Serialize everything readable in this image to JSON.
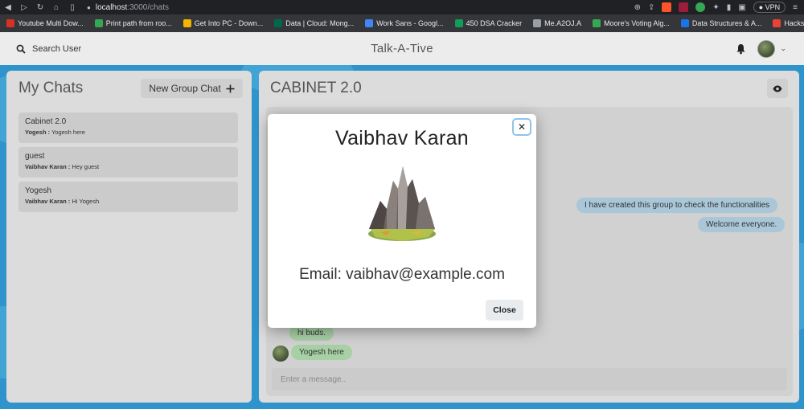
{
  "browser": {
    "url_host": "localhost",
    "url_path": ":3000/chats",
    "vpn_label": "VPN",
    "bookmarks": [
      {
        "label": "Youtube Multi Dow...",
        "color": "#d93025"
      },
      {
        "label": "Print path from roo...",
        "color": "#34a853"
      },
      {
        "label": "Get Into PC - Down...",
        "color": "#f4b400"
      },
      {
        "label": "Data | Cloud: Mong...",
        "color": "#00684a"
      },
      {
        "label": "Work Sans - Googl...",
        "color": "#4285f4"
      },
      {
        "label": "450 DSA Cracker",
        "color": "#0f9d58"
      },
      {
        "label": "Me.A2OJ.A",
        "color": "#9aa0a6"
      },
      {
        "label": "Moore's Voting Alg...",
        "color": "#34a853"
      },
      {
        "label": "Data Structures & A...",
        "color": "#1a73e8"
      },
      {
        "label": "Hacksnation.com",
        "color": "#ea4335"
      }
    ],
    "more_label": "»"
  },
  "header": {
    "search_label": "Search User",
    "app_title": "Talk-A-Tive"
  },
  "mychats": {
    "title": "My Chats",
    "new_group_label": "New Group Chat",
    "items": [
      {
        "name": "Cabinet 2.0",
        "sender": "Yogesh :",
        "text": " Yogesh here"
      },
      {
        "name": "guest",
        "sender": "Vaibhav Karan :",
        "text": " Hey guest"
      },
      {
        "name": "Yogesh",
        "sender": "Vaibhav Karan :",
        "text": " Hi Yogesh"
      }
    ]
  },
  "chat": {
    "title": "CABINET 2.0",
    "messages": [
      {
        "text": "I have created this group to check the functionalities"
      },
      {
        "text": "Welcome everyone."
      },
      {
        "text": "hi buds."
      },
      {
        "text": "Yogesh here"
      }
    ],
    "input_placeholder": "Enter a message.."
  },
  "modal": {
    "name": "Vaibhav Karan",
    "email": "Email: vaibhav@example.com",
    "close_label": "Close"
  },
  "colors": {
    "page_bg": "#2f94cc",
    "panel_bg": "#dcdcdc",
    "sent_bubble": "#a9c7d8",
    "received_bubble": "#a7d0a5"
  }
}
